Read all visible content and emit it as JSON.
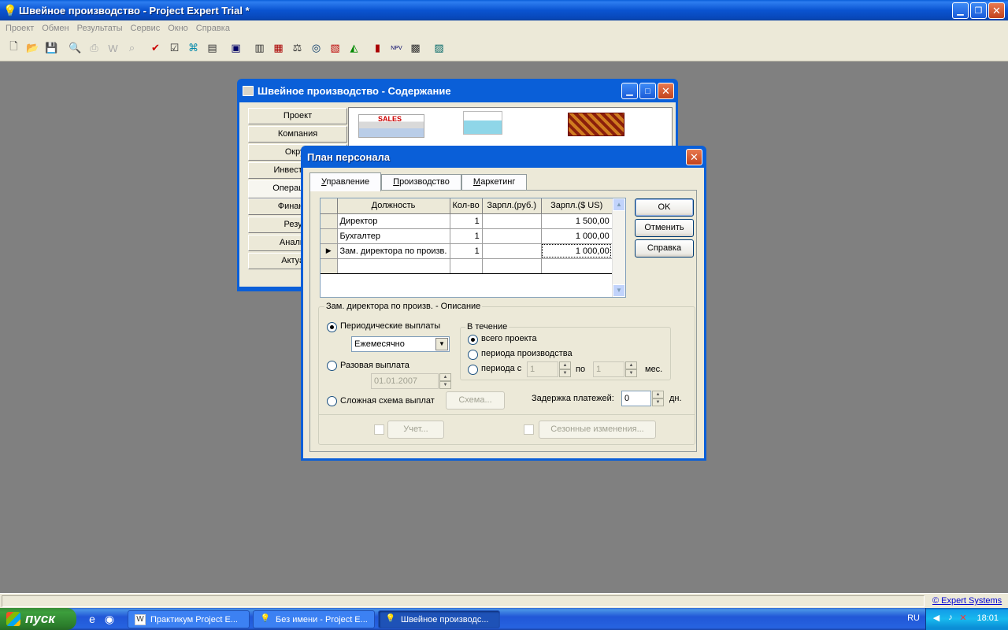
{
  "app": {
    "title": "Швейное производство - Project Expert Trial *",
    "menu": [
      "Проект",
      "Обмен",
      "Результаты",
      "Сервис",
      "Окно",
      "Справка"
    ]
  },
  "contents_window": {
    "title": "Швейное производство - Содержание",
    "nav": [
      "Проект",
      "Компания",
      "Окруж",
      "Инвестицио",
      "Операционн",
      "Финансир",
      "Резуль",
      "Анализ п",
      "Актуали"
    ],
    "image_labels": [
      "SALES"
    ]
  },
  "dialog": {
    "title": "План персонала",
    "tabs": [
      {
        "prefix": "",
        "key": "У",
        "rest": "правление"
      },
      {
        "prefix": "",
        "key": "П",
        "rest": "роизводство"
      },
      {
        "prefix": "",
        "key": "М",
        "rest": "аркетинг"
      }
    ],
    "grid": {
      "columns": [
        "Должность",
        "Кол-во",
        "Зарпл.(руб.)",
        "Зарпл.($ US)"
      ],
      "rows": [
        {
          "name": "Директор",
          "qty": "1",
          "rub": "",
          "usd": "1 500,00"
        },
        {
          "name": "Бухгалтер",
          "qty": "1",
          "rub": "",
          "usd": "1 000,00"
        },
        {
          "name": "Зам. директора по произв.",
          "qty": "1",
          "rub": "",
          "usd": "1 000,00"
        }
      ]
    },
    "buttons": {
      "ok": "OK",
      "cancel": "Отменить",
      "help": "Справка"
    },
    "description": {
      "title": "Зам. директора по произв. - Описание",
      "periodic": "Периодические выплаты",
      "frequency": "Ежемесячно",
      "onetime": "Разовая выплата",
      "onetime_date": "01.01.2007",
      "complex": "Сложная схема выплат",
      "scheme_button": "Схема...",
      "during": {
        "title": "В течение",
        "whole": "всего проекта",
        "production": "периода производства",
        "period_from": "периода с",
        "from_value": "1",
        "to_label": "по",
        "to_value": "1",
        "months": "мес."
      },
      "delay_label": "Задержка платежей:",
      "delay_value": "0",
      "delay_unit": "дн.",
      "accounting_button": "Учет...",
      "seasonal_button": "Сезонные изменения..."
    }
  },
  "status": {
    "copyright": "© Expert Systems"
  },
  "taskbar": {
    "start": "пуск",
    "tasks": [
      "Практикум Project E...",
      "Без имени - Project E...",
      "Швейное производс..."
    ],
    "lang": "RU",
    "clock": "18:01"
  }
}
